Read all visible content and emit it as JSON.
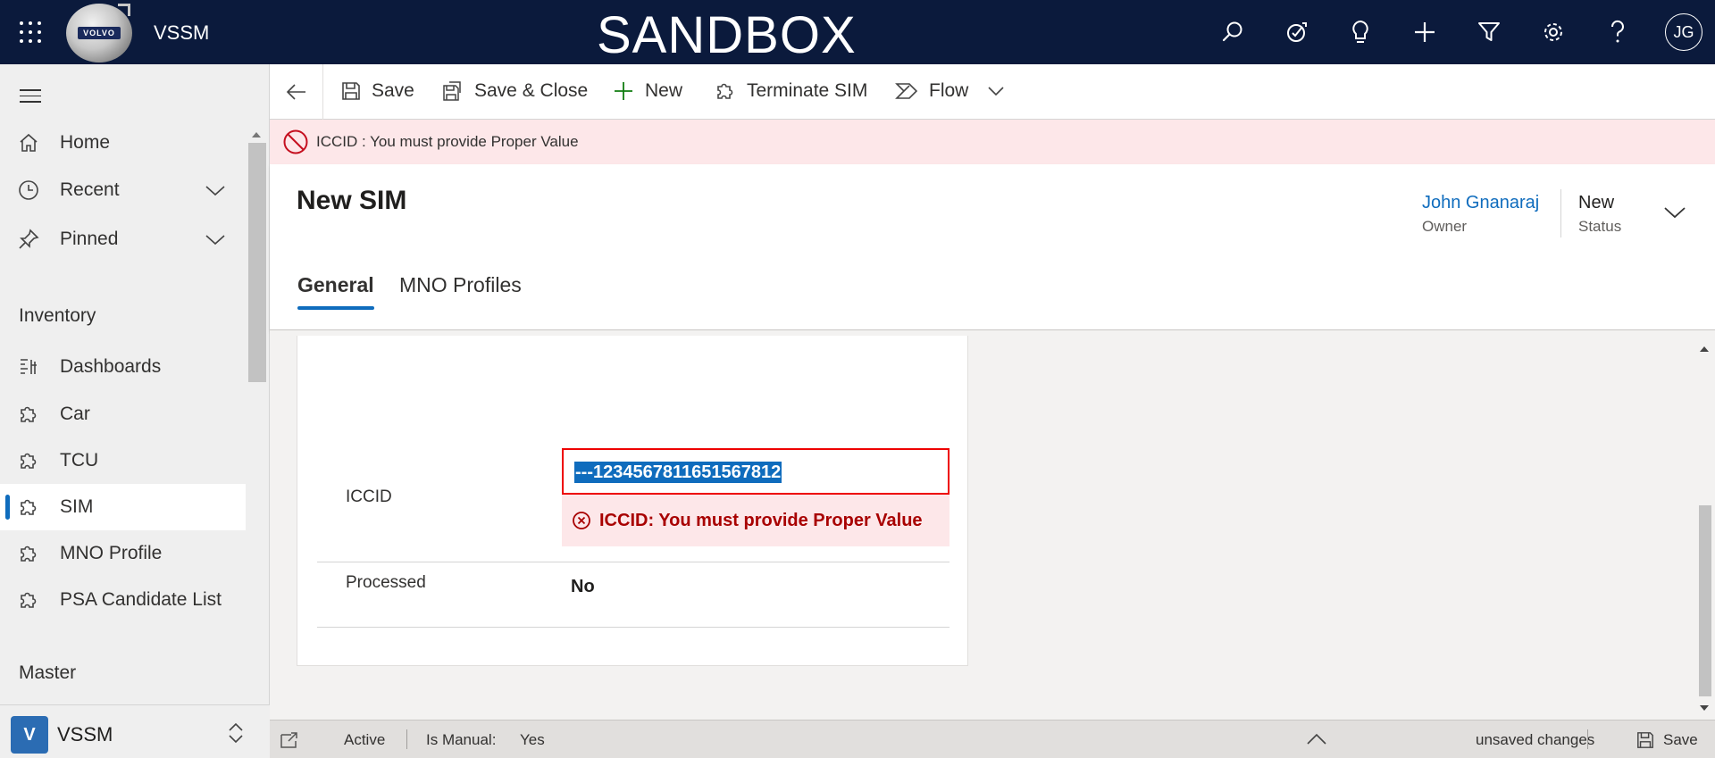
{
  "topbar": {
    "app_name": "VSSM",
    "environment": "SANDBOX",
    "logo_text": "VOLVO",
    "avatar_initials": "JG",
    "bg_color": "#0b1a3c",
    "icons": [
      "search-icon",
      "task-icon",
      "lightbulb-icon",
      "plus-icon",
      "filter-icon",
      "gear-icon",
      "help-icon"
    ]
  },
  "sidebar": {
    "nav": [
      {
        "label": "Home",
        "icon": "home-icon"
      },
      {
        "label": "Recent",
        "icon": "clock-icon"
      },
      {
        "label": "Pinned",
        "icon": "pin-icon"
      }
    ],
    "group_inventory": "Inventory",
    "inventory_items": [
      {
        "label": "Dashboards",
        "icon": "dashboard-icon"
      },
      {
        "label": "Car",
        "icon": "puzzle-icon"
      },
      {
        "label": "TCU",
        "icon": "puzzle-icon"
      },
      {
        "label": "SIM",
        "icon": "puzzle-icon",
        "active": true
      },
      {
        "label": "MNO Profile",
        "icon": "puzzle-icon"
      },
      {
        "label": "PSA Candidate List",
        "icon": "puzzle-icon"
      }
    ],
    "group_master": "Master",
    "app_switcher": {
      "badge": "V",
      "name": "VSSM"
    }
  },
  "commandbar": {
    "save": "Save",
    "save_close": "Save & Close",
    "new": "New",
    "terminate": "Terminate SIM",
    "flow": "Flow"
  },
  "banner": {
    "message": "ICCID : You must provide Proper Value"
  },
  "header": {
    "title": "New SIM",
    "owner_value": "John Gnanaraj",
    "owner_label": "Owner",
    "status_value": "New",
    "status_label": "Status",
    "tabs": [
      "General",
      "MNO Profiles"
    ]
  },
  "form": {
    "iccid_label": "ICCID",
    "required_marker": "*",
    "iccid_value": "---1234567811651567812",
    "iccid_error": "ICCID: You must provide Proper Value",
    "processed_label": "Processed",
    "processed_value": "No"
  },
  "footer": {
    "state": "Active",
    "is_manual_label": "Is Manual:",
    "is_manual_value": "Yes",
    "unsaved": "unsaved changes",
    "save": "Save"
  }
}
